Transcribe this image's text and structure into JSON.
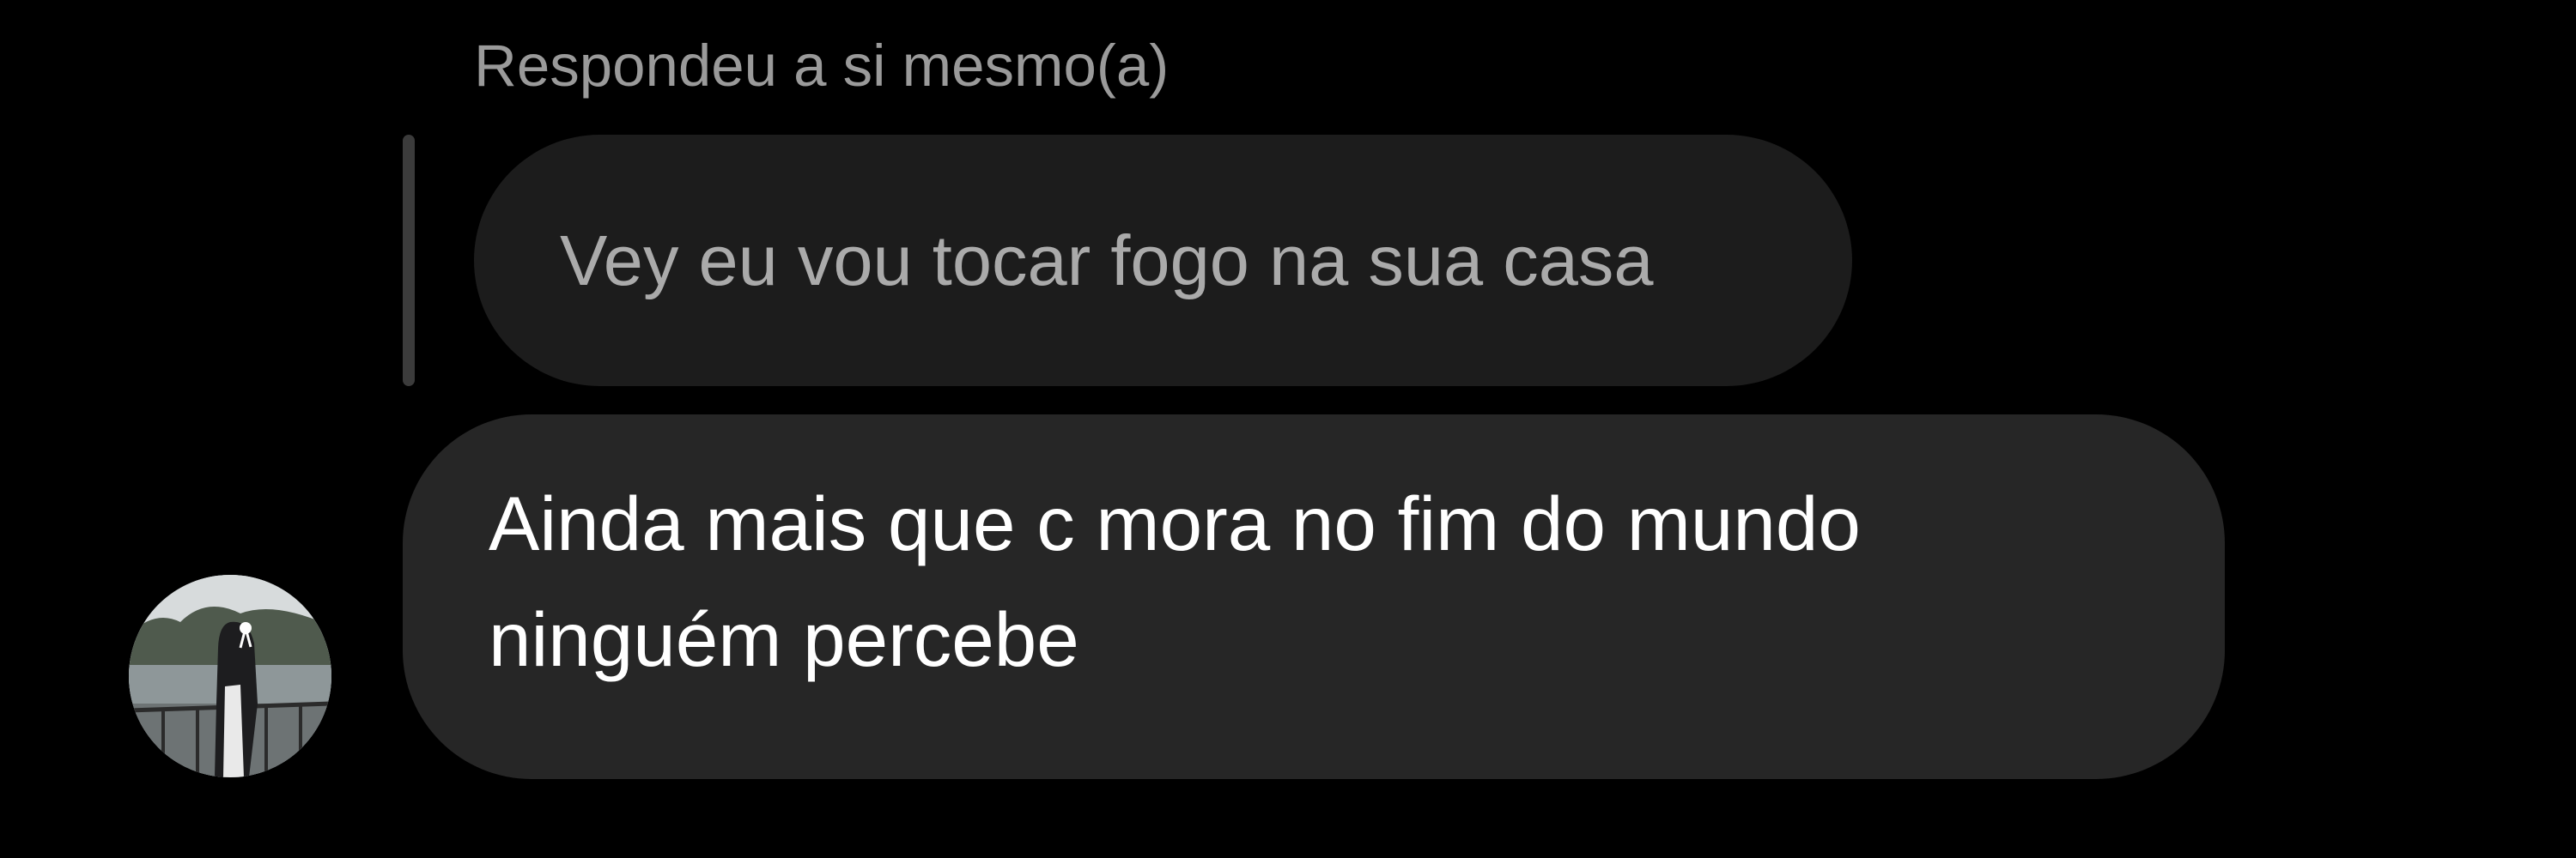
{
  "reply": {
    "label": "Respondeu a si mesmo(a)",
    "quoted_text": "Vey eu vou tocar fogo na sua casa"
  },
  "message": {
    "line1": "Ainda mais que c mora no fim do mundo",
    "line2": "ninguém percebe"
  },
  "colors": {
    "background": "#000000",
    "message_bubble": "#262626",
    "quoted_bubble": "#1c1c1c",
    "muted_text": "#9a9a9a",
    "message_text": "#ffffff"
  },
  "icons": {
    "avatar": "user-avatar-photo"
  }
}
